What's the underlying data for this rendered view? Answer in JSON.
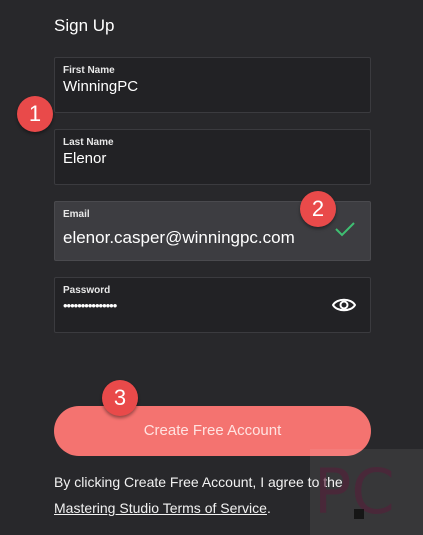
{
  "form": {
    "title": "Sign Up",
    "first_name": {
      "label": "First Name",
      "value": "WinningPC"
    },
    "last_name": {
      "label": "Last Name",
      "value": "Elenor"
    },
    "email": {
      "label": "Email",
      "value": "elenor.casper@winningpc.com"
    },
    "password": {
      "label": "Password",
      "value": "•••••••••••••••"
    },
    "submit_label": "Create Free Account",
    "terms_text": "By clicking Create Free Account, I agree to the",
    "terms_link": "Mastering Studio Terms of Service",
    "terms_suffix": "."
  },
  "badges": {
    "first": "1",
    "second": "2",
    "third": "3"
  },
  "watermark": {
    "text": "PC"
  },
  "icons": {
    "email_valid": "check-icon",
    "password_reveal": "eye-icon"
  },
  "colors": {
    "background": "#28282b",
    "accent": "#f47370",
    "badge": "#e94a4a",
    "valid": "#3fbf72"
  }
}
